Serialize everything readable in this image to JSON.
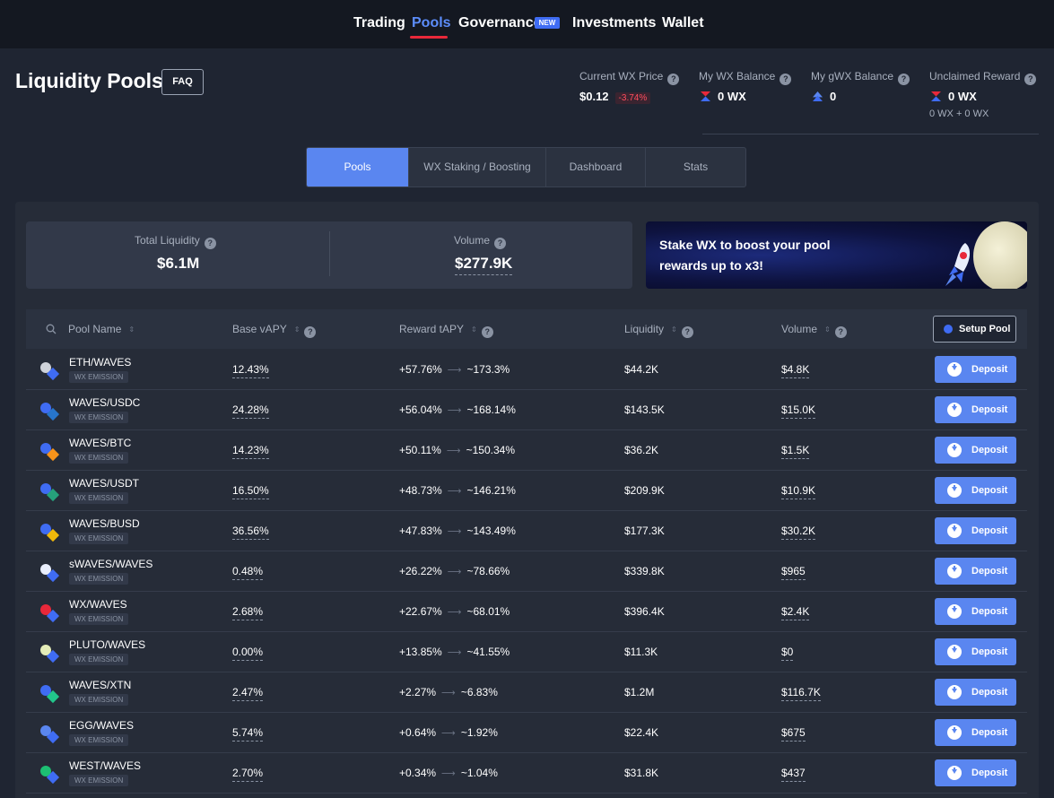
{
  "nav": {
    "items": [
      {
        "label": "Trading"
      },
      {
        "label": "Pools"
      },
      {
        "label": "Governance"
      },
      {
        "label": "Investments"
      },
      {
        "label": "Wallet"
      }
    ],
    "new_badge": "NEW",
    "active": "Pools"
  },
  "header": {
    "title": "Liquidity Pools",
    "faq": "FAQ",
    "wx_price": {
      "label": "Current WX Price",
      "value": "$0.12",
      "change": "-3.74%"
    },
    "wx_balance": {
      "label": "My WX Balance",
      "value": "0 WX"
    },
    "gwx_balance": {
      "label": "My gWX Balance",
      "value": "0"
    },
    "unclaimed": {
      "label": "Unclaimed Reward",
      "value": "0 WX",
      "sub": "0 WX + 0 WX"
    }
  },
  "tabs": [
    {
      "label": "Pools",
      "active": true
    },
    {
      "label": "WX Staking / Boosting",
      "active": false
    },
    {
      "label": "Dashboard",
      "active": false
    },
    {
      "label": "Stats",
      "active": false
    }
  ],
  "summary": {
    "liquidity_label": "Total Liquidity",
    "liquidity_value": "$6.1M",
    "volume_label": "Volume",
    "volume_value": "$277.9K"
  },
  "banner": {
    "text": "Stake WX to boost your pool rewards up to x3!"
  },
  "table": {
    "headers": {
      "pool_name": "Pool Name",
      "base_vapy": "Base vAPY",
      "reward_tapy": "Reward tAPY",
      "liquidity": "Liquidity",
      "volume": "Volume"
    },
    "setup_label": "Setup Pool",
    "emission_label": "WX EMISSION",
    "deposit_label": "Deposit",
    "rows": [
      {
        "pair": "ETH/WAVES",
        "base": "12.43%",
        "reward_from": "+57.76%",
        "reward_to": "~173.3%",
        "liquidity": "$44.2K",
        "volume": "$4.8K"
      },
      {
        "pair": "WAVES/USDC",
        "base": "24.28%",
        "reward_from": "+56.04%",
        "reward_to": "~168.14%",
        "liquidity": "$143.5K",
        "volume": "$15.0K"
      },
      {
        "pair": "WAVES/BTC",
        "base": "14.23%",
        "reward_from": "+50.11%",
        "reward_to": "~150.34%",
        "liquidity": "$36.2K",
        "volume": "$1.5K"
      },
      {
        "pair": "WAVES/USDT",
        "base": "16.50%",
        "reward_from": "+48.73%",
        "reward_to": "~146.21%",
        "liquidity": "$209.9K",
        "volume": "$10.9K"
      },
      {
        "pair": "WAVES/BUSD",
        "base": "36.56%",
        "reward_from": "+47.83%",
        "reward_to": "~143.49%",
        "liquidity": "$177.3K",
        "volume": "$30.2K"
      },
      {
        "pair": "sWAVES/WAVES",
        "base": "0.48%",
        "reward_from": "+26.22%",
        "reward_to": "~78.66%",
        "liquidity": "$339.8K",
        "volume": "$965"
      },
      {
        "pair": "WX/WAVES",
        "base": "2.68%",
        "reward_from": "+22.67%",
        "reward_to": "~68.01%",
        "liquidity": "$396.4K",
        "volume": "$2.4K"
      },
      {
        "pair": "PLUTO/WAVES",
        "base": "0.00%",
        "reward_from": "+13.85%",
        "reward_to": "~41.55%",
        "liquidity": "$11.3K",
        "volume": "$0"
      },
      {
        "pair": "WAVES/XTN",
        "base": "2.47%",
        "reward_from": "+2.27%",
        "reward_to": "~6.83%",
        "liquidity": "$1.2M",
        "volume": "$116.7K"
      },
      {
        "pair": "EGG/WAVES",
        "base": "5.74%",
        "reward_from": "+0.64%",
        "reward_to": "~1.92%",
        "liquidity": "$22.4K",
        "volume": "$675"
      },
      {
        "pair": "WEST/WAVES",
        "base": "2.70%",
        "reward_from": "+0.34%",
        "reward_to": "~1.04%",
        "liquidity": "$31.8K",
        "volume": "$437"
      }
    ]
  },
  "colors": {
    "accent": "#5a86f0",
    "negative": "#ff4d5e",
    "nav_active": "#5c8dfb",
    "underline": "#e8283a"
  }
}
